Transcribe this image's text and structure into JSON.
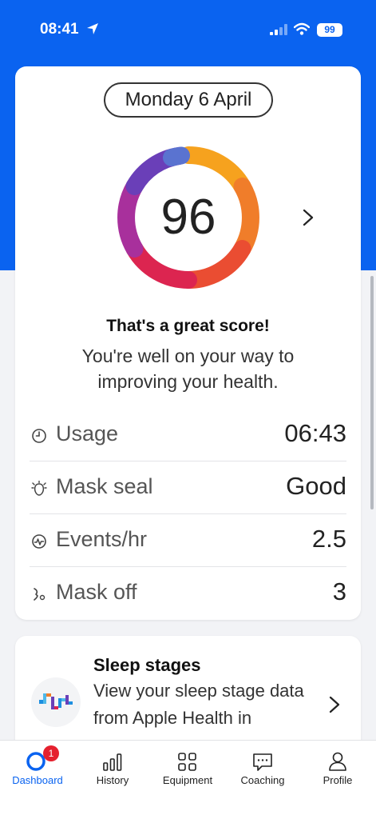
{
  "status_bar": {
    "time": "08:41",
    "battery": "99"
  },
  "colors": {
    "brand": "#0a63f0",
    "badge": "#e5202e"
  },
  "summary_card": {
    "date": "Monday 6 April",
    "score": "96",
    "headline": "That's a great score!",
    "message": "You're well on your way to improving your health.",
    "metrics": [
      {
        "icon": "clock-icon",
        "label": "Usage",
        "value": "06:43"
      },
      {
        "icon": "mask-seal-icon",
        "label": "Mask seal",
        "value": "Good"
      },
      {
        "icon": "pulse-icon",
        "label": "Events/hr",
        "value": "2.5"
      },
      {
        "icon": "face-icon",
        "label": "Mask off",
        "value": "3"
      }
    ]
  },
  "sleep_card": {
    "title": "Sleep stages",
    "description": "View your sleep stage data from Apple Health in"
  },
  "tabs": [
    {
      "icon": "dashboard-icon",
      "label": "Dashboard",
      "badge": "1",
      "active": true
    },
    {
      "icon": "bar-chart-icon",
      "label": "History"
    },
    {
      "icon": "grid-icon",
      "label": "Equipment"
    },
    {
      "icon": "chat-icon",
      "label": "Coaching"
    },
    {
      "icon": "person-icon",
      "label": "Profile"
    }
  ]
}
